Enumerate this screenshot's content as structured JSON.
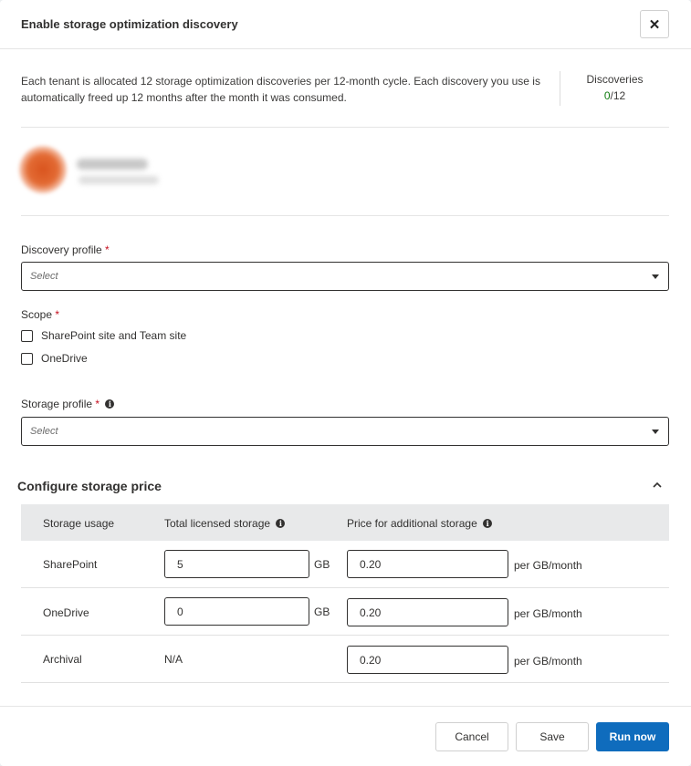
{
  "dialog": {
    "title": "Enable storage optimization discovery",
    "close_label": "✕"
  },
  "info": {
    "text": "Each tenant is allocated 12 storage optimization discoveries per 12-month cycle. Each discovery you use is automatically freed up 12 months after the month it was consumed.",
    "discoveries_label": "Discoveries",
    "discoveries_used": "0",
    "discoveries_total": "/12"
  },
  "discovery_profile": {
    "label": "Discovery profile",
    "required_mark": "*",
    "placeholder": "Select"
  },
  "scope": {
    "label": "Scope",
    "required_mark": "*",
    "options": [
      {
        "label": "SharePoint site and Team site",
        "checked": false
      },
      {
        "label": "OneDrive",
        "checked": false
      }
    ]
  },
  "storage_profile": {
    "label": "Storage profile",
    "required_mark": "*",
    "placeholder": "Select"
  },
  "storage_price": {
    "title": "Configure storage price",
    "headers": {
      "usage": "Storage usage",
      "licensed": "Total licensed storage",
      "price": "Price for additional storage"
    },
    "rows": [
      {
        "name": "SharePoint",
        "licensed": "5",
        "licensed_unit": "GB",
        "price": "0.20",
        "price_unit": "per GB/month"
      },
      {
        "name": "OneDrive",
        "licensed": "0",
        "licensed_unit": "GB",
        "price": "0.20",
        "price_unit": "per GB/month"
      },
      {
        "name": "Archival",
        "licensed": "N/A",
        "price": "0.20",
        "price_unit": "per GB/month"
      }
    ]
  },
  "footer": {
    "cancel": "Cancel",
    "save": "Save",
    "run_now": "Run now"
  },
  "colors": {
    "primary": "#0f6cbd",
    "required": "#c50f1f",
    "discoveries_used": "#107c10"
  }
}
